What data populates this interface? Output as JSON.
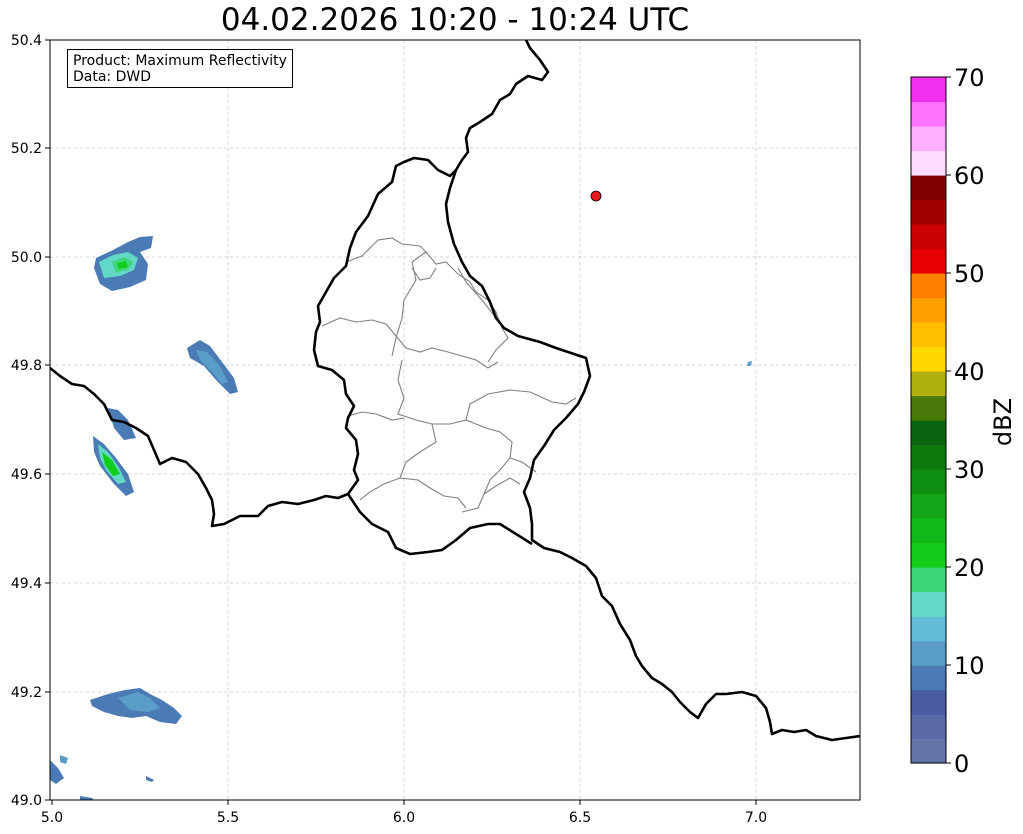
{
  "title": "04.02.2026 10:20 - 10:24 UTC",
  "info": {
    "product_line": "Product: Maximum Reflectivity",
    "data_line": "Data: DWD"
  },
  "axes": {
    "x_ticks": [
      "5.0",
      "5.5",
      "6.0",
      "6.5",
      "7.0"
    ],
    "y_ticks": [
      "50.4",
      "50.2",
      "50.0",
      "49.8",
      "49.6",
      "49.4",
      "49.2",
      "49.0"
    ],
    "x_range": [
      5.0,
      7.3
    ],
    "y_range": [
      49.0,
      50.4
    ],
    "grid": true
  },
  "marker": {
    "lon": 6.55,
    "lat": 50.11,
    "color": "#e41a1c"
  },
  "colorbar": {
    "label": "dBZ",
    "ticks": [
      "0",
      "10",
      "20",
      "30",
      "40",
      "50",
      "60",
      "70"
    ],
    "range": [
      0,
      70
    ],
    "colors": [
      "#6673a8",
      "#5a6aa8",
      "#4a5ca3",
      "#4a7bb4",
      "#5b9dc9",
      "#63bdd7",
      "#62d8c7",
      "#3fd67a",
      "#12cc1a",
      "#12b81a",
      "#12a518",
      "#0f8f12",
      "#0d7a10",
      "#0a6410",
      "#4a7a0a",
      "#b0b010",
      "#ffd700",
      "#ffbf00",
      "#ff9f00",
      "#ff7f00",
      "#e60000",
      "#c80000",
      "#a00000",
      "#800000",
      "#ffdcff",
      "#ffafff",
      "#ff73ff",
      "#f030f0"
    ]
  },
  "colors": {
    "border": "#000000",
    "district": "#808080",
    "grid": "#c8c8c8"
  }
}
